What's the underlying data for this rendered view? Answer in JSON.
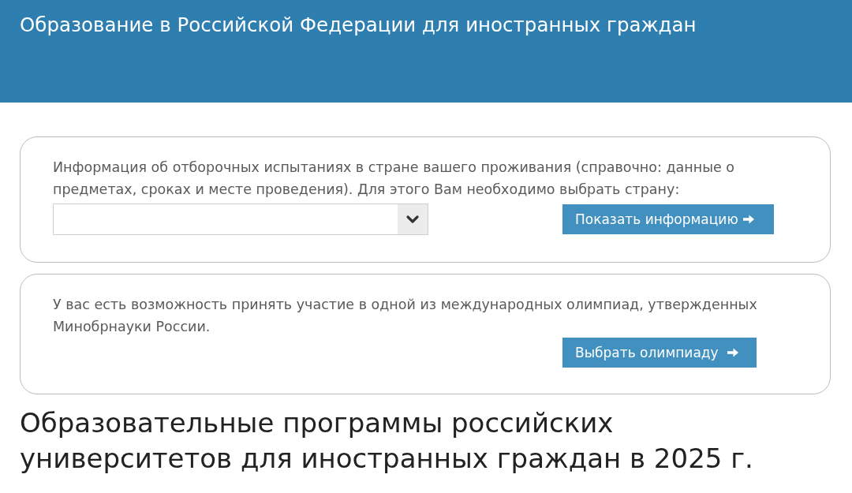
{
  "header": {
    "title": "Образование в Российской Федерации для иностранных граждан"
  },
  "panels": [
    {
      "kind": "select",
      "text": "Информация об отборочных испытаниях в стране вашего проживания (справочно: данные о предметах, сроках и месте проведения). Для этого Вам необходимо выбрать страну:",
      "button": "Показать информацию"
    },
    {
      "kind": "plain",
      "text": "У вас есть возможность принять участие в одной из международных олимпиад, утвержденных Минобрнауки России.",
      "button": "Выбрать олимпиаду"
    }
  ],
  "heading": "Образовательные программы российских университетов для иностранных граждан в 2025 г."
}
